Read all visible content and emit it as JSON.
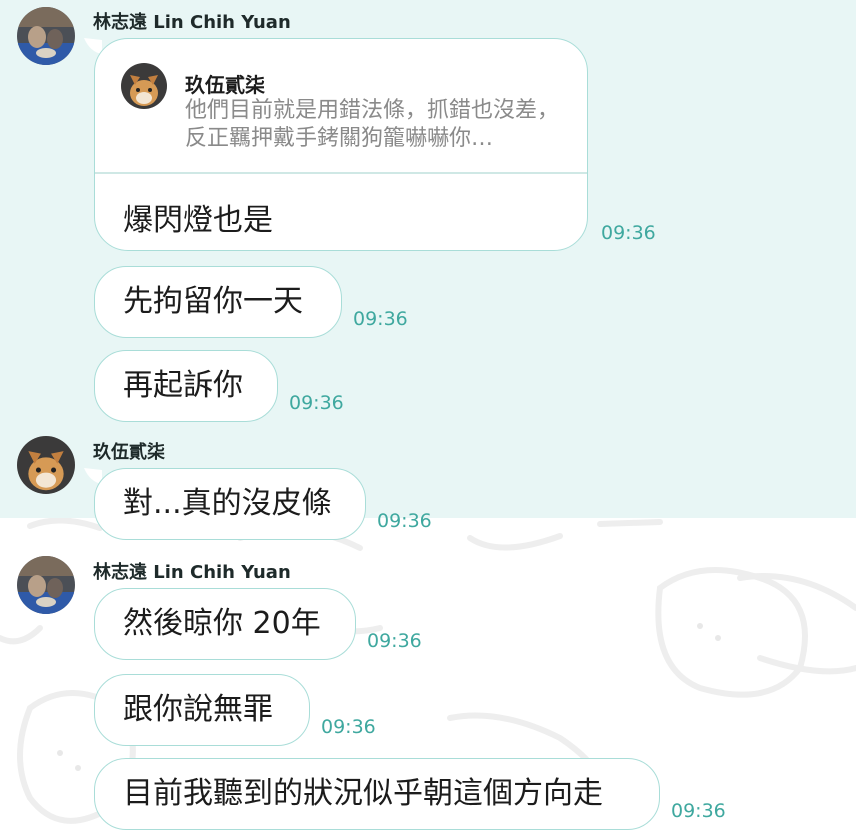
{
  "messages": [
    {
      "sender": "林志遠 Lin Chih Yuan",
      "reply": {
        "quoted_name": "玖伍貳柒",
        "quoted_text": "他們目前就是用錯法條，抓錯也沒差，反正羈押戴手銬關狗籠嚇嚇你…",
        "text": "爆閃燈也是"
      },
      "time": "09:36"
    },
    {
      "text": "先拘留你一天",
      "time": "09:36"
    },
    {
      "text": "再起訴你",
      "time": "09:36"
    },
    {
      "sender": "玖伍貳柒",
      "text": "對...真的沒皮條",
      "time": "09:36"
    },
    {
      "sender": "林志遠 Lin Chih Yuan",
      "text": "然後晾你 20年",
      "time": "09:36"
    },
    {
      "text": "跟你說無罪",
      "time": "09:36"
    },
    {
      "text": "目前我聽到的狀況似乎朝這個方向走",
      "time": "09:36"
    }
  ],
  "colors": {
    "chat_bg_top": "#e8f6f5",
    "bubble_border": "#a9ddd8",
    "time": "#3fa89f"
  },
  "icons": [
    "avatar-cats-icon",
    "avatar-dog-mask-icon"
  ]
}
